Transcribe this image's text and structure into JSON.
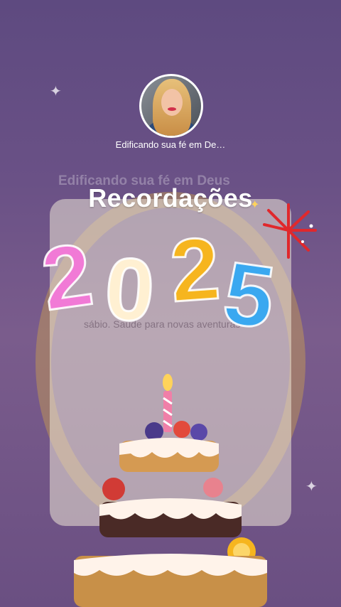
{
  "background": {
    "title": "Edificando sua fé em Deus",
    "text": "sábio. Saúde para novas aventuras"
  },
  "channel": {
    "avatar_alt": "profile-photo",
    "name": "Edificando sua fé em De…"
  },
  "headline": "Recordações",
  "year": [
    "2",
    "0",
    "2",
    "5"
  ],
  "colors": {
    "digit_2a": "#f17ad6",
    "digit_0": "#fff0d2",
    "digit_2b": "#f6b51e",
    "digit_5": "#3aa8f0",
    "background_top": "#5e4a80",
    "background_bottom": "#6a4f82"
  },
  "icons": [
    "sparkle-icon",
    "firework-icon",
    "candle-icon",
    "cake-icon"
  ]
}
